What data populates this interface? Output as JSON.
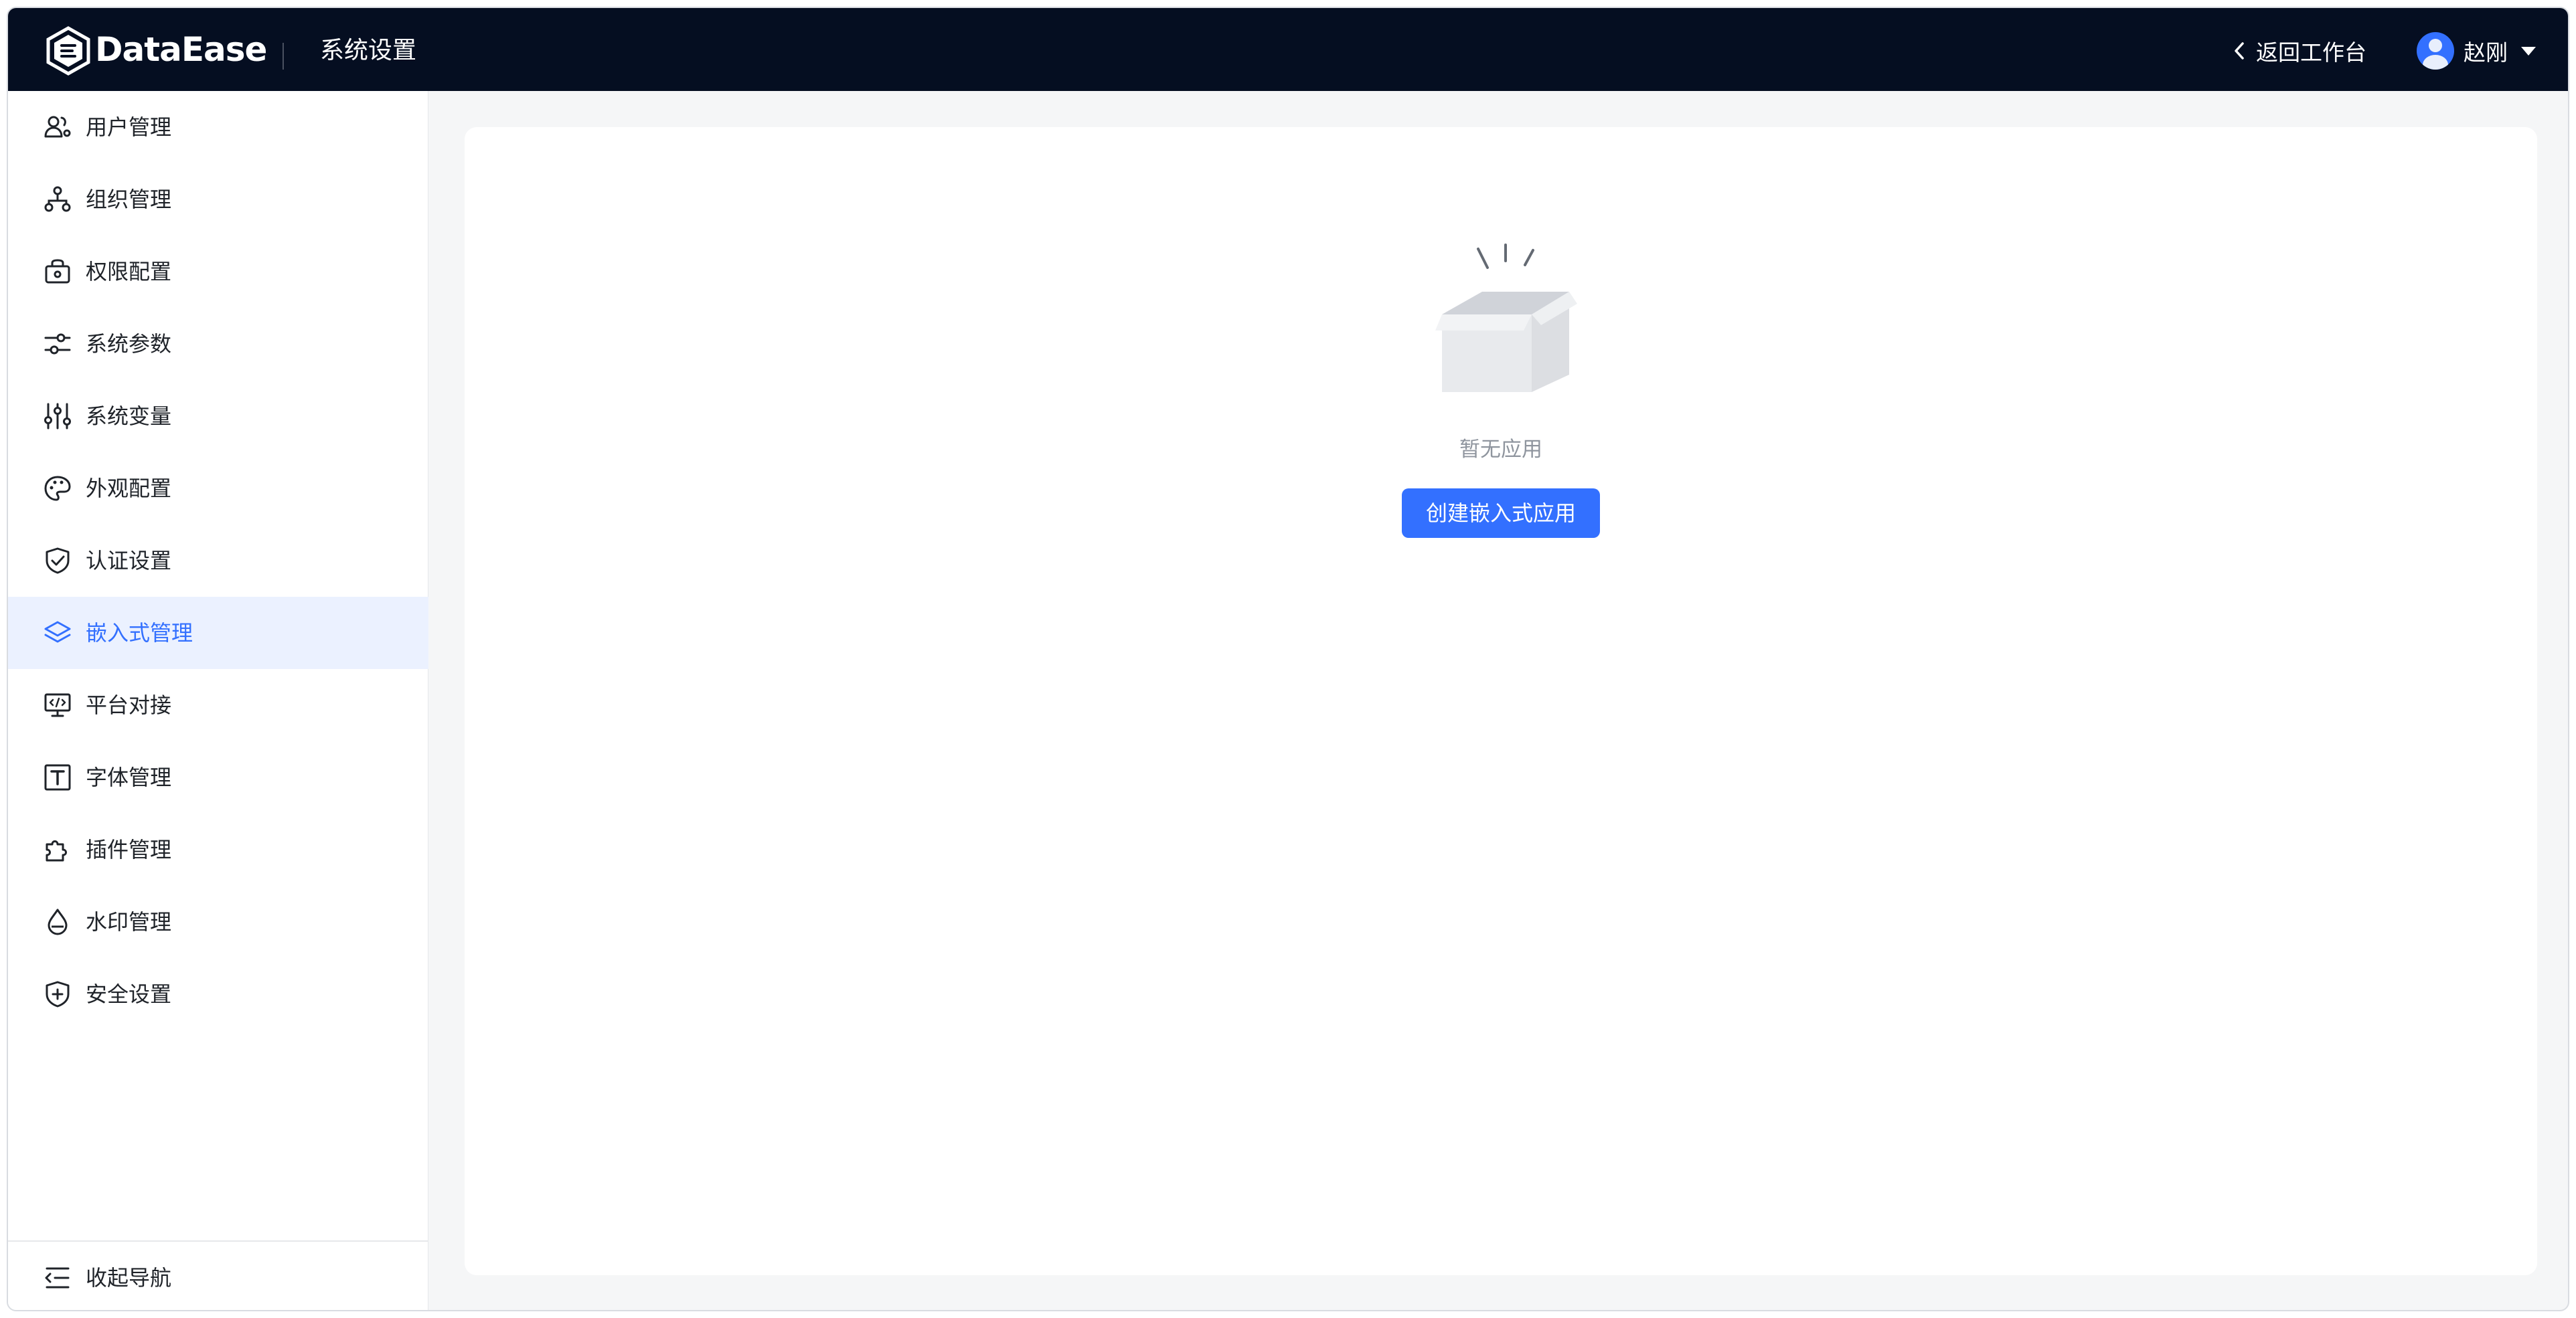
{
  "header": {
    "brand": "DataEase",
    "section_title": "系统设置",
    "back_label": "返回工作台",
    "user_name": "赵刚",
    "logo_icon": "dataease-logo-icon",
    "background_color": "#050e21"
  },
  "sidebar": {
    "items": [
      {
        "label": "用户管理",
        "icon": "user-management-icon"
      },
      {
        "label": "组织管理",
        "icon": "org-tree-icon"
      },
      {
        "label": "权限配置",
        "icon": "permission-lock-icon"
      },
      {
        "label": "系统参数",
        "icon": "sliders-icon"
      },
      {
        "label": "系统变量",
        "icon": "vertical-sliders-icon"
      },
      {
        "label": "外观配置",
        "icon": "palette-icon"
      },
      {
        "label": "认证设置",
        "icon": "shield-check-icon"
      },
      {
        "label": "嵌入式管理",
        "icon": "layers-icon",
        "active": true
      },
      {
        "label": "平台对接",
        "icon": "monitor-code-icon"
      },
      {
        "label": "字体管理",
        "icon": "font-box-icon"
      },
      {
        "label": "插件管理",
        "icon": "puzzle-icon"
      },
      {
        "label": "水印管理",
        "icon": "water-drop-icon"
      },
      {
        "label": "安全设置",
        "icon": "shield-plus-icon"
      }
    ],
    "collapse_label": "收起导航",
    "active_color": "#3370ff",
    "active_bg": "#ebf1ff"
  },
  "main": {
    "empty_text": "暂无应用",
    "create_button_label": "创建嵌入式应用",
    "empty_icon": "empty-box-icon"
  }
}
